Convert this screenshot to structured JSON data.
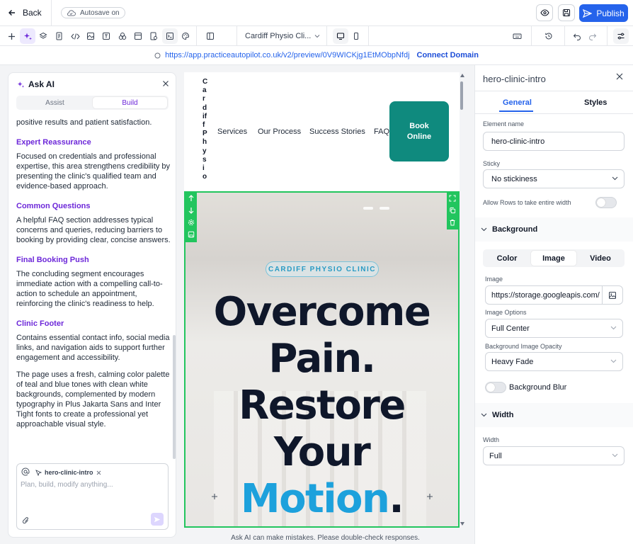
{
  "topbar": {
    "back_label": "Back",
    "autosave_label": "Autosave on",
    "publish_label": "Publish"
  },
  "toolbar": {
    "page_name": "Cardiff Physio Cli..."
  },
  "urlbar": {
    "url": "https://app.practiceautopilot.co.uk/v2/preview/0V9WICKjg1EtMObpNfdj",
    "connect_label": "Connect Domain"
  },
  "ai_panel": {
    "title": "Ask AI",
    "tabs": [
      "Assist",
      "Build"
    ],
    "active_tab": "Build",
    "partial_line": "positive results and patient satisfaction.",
    "sections": [
      {
        "heading": "Expert Reassurance",
        "body": "Focused on credentials and professional expertise, this area strengthens credibility by presenting the clinic's qualified team and evidence-based approach."
      },
      {
        "heading": "Common Questions",
        "body": "A helpful FAQ section addresses typical concerns and queries, reducing barriers to booking by providing clear, concise answers."
      },
      {
        "heading": "Final Booking Push",
        "body": "The concluding segment encourages immediate action with a compelling call-to-action to schedule an appointment, reinforcing the clinic's readiness to help."
      },
      {
        "heading": "Clinic Footer",
        "body": "Contains essential contact info, social media links, and navigation aids to support further engagement and accessibility."
      }
    ],
    "summary": "The page uses a fresh, calming color palette of teal and blue tones with clean white backgrounds, complemented by modern typography in Plus Jakarta Sans and Inter Tight fonts to create a professional yet approachable visual style.",
    "chip_label": "hero-clinic-intro",
    "input_placeholder": "Plan, build, modify anything..."
  },
  "canvas": {
    "logo_text": "CardiffPhysio",
    "nav_items": [
      "Services",
      "Our Process",
      "Success Stories",
      "FAQ"
    ],
    "book_button": "Book Online",
    "badge": "CARDIFF PHYSIO CLINIC",
    "headline_lines": [
      "Overcome",
      "Pain.",
      "Restore",
      "Your"
    ],
    "headline_accent": "Motion",
    "headline_end": "."
  },
  "right_panel": {
    "title": "hero-clinic-intro",
    "tabs": [
      "General",
      "Styles"
    ],
    "active_tab": "General",
    "element_name_label": "Element name",
    "element_name_value": "hero-clinic-intro",
    "sticky_label": "Sticky",
    "sticky_value": "No stickiness",
    "rows_label": "Allow Rows to take entire width",
    "background_section": "Background",
    "bg_tabs": [
      "Color",
      "Image",
      "Video"
    ],
    "bg_active": "Image",
    "image_label": "Image",
    "image_value": "https://storage.googleapis.com/",
    "image_options_label": "Image Options",
    "image_options_value": "Full Center",
    "opacity_label": "Background Image Opacity",
    "opacity_value": "Heavy Fade",
    "blur_label": "Background Blur",
    "width_section": "Width",
    "width_label": "Width",
    "width_value": "Full"
  },
  "footer_note": "Ask AI can make mistakes. Please double-check responses.",
  "colors": {
    "accent": "#2563eb",
    "ai_purple": "#6d28d9",
    "teal": "#0f8a7e",
    "selection_green": "#22c55e",
    "headline_blue": "#1da1dc"
  }
}
